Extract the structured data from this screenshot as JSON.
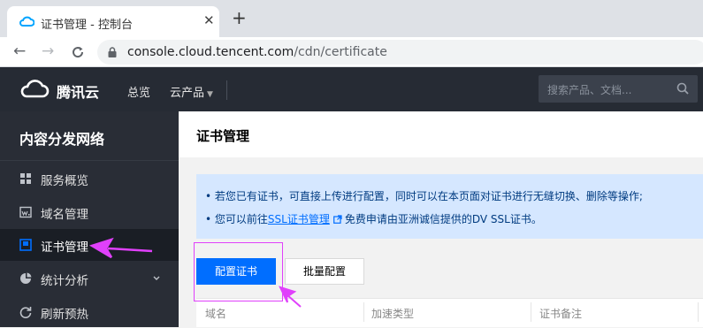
{
  "browser": {
    "tab_title": "证书管理 - 控制台",
    "new_tab_symbol": "+",
    "close_symbol": "✕",
    "url_host": "console.cloud.tencent.com",
    "url_path": "/cdn/certificate"
  },
  "topbar": {
    "brand": "腾讯云",
    "nav": [
      "总览",
      "云产品"
    ],
    "search_placeholder": "搜索产品、文档..."
  },
  "sidebar": {
    "title": "内容分发网络",
    "items": [
      {
        "label": "服务概览",
        "icon": "grid-icon"
      },
      {
        "label": "域名管理",
        "icon": "domain-icon"
      },
      {
        "label": "证书管理",
        "icon": "certificate-icon",
        "active": true
      },
      {
        "label": "统计分析",
        "icon": "pie-chart-icon",
        "expandable": true
      },
      {
        "label": "刷新预热",
        "icon": "refresh-icon"
      }
    ]
  },
  "main": {
    "title": "证书管理",
    "notice": {
      "line1": "若您已有证书，可直接上传进行配置，同时可以在本页面对证书进行无缝切换、删除等操作;",
      "line2_prefix": "您可以前往",
      "line2_link": "SSL证书管理",
      "line2_suffix": "免费申请由亚洲诚信提供的DV SSL证书。"
    },
    "buttons": {
      "configure": "配置证书",
      "batch": "批量配置"
    },
    "table": {
      "columns": [
        "域名",
        "加速类型",
        "证书备注"
      ]
    }
  },
  "colors": {
    "accent": "#006eff",
    "topbar_bg": "#262b34",
    "sidebar_bg": "#292d36",
    "notice_bg": "#d5e7ff",
    "annotation": "#e040fb"
  }
}
